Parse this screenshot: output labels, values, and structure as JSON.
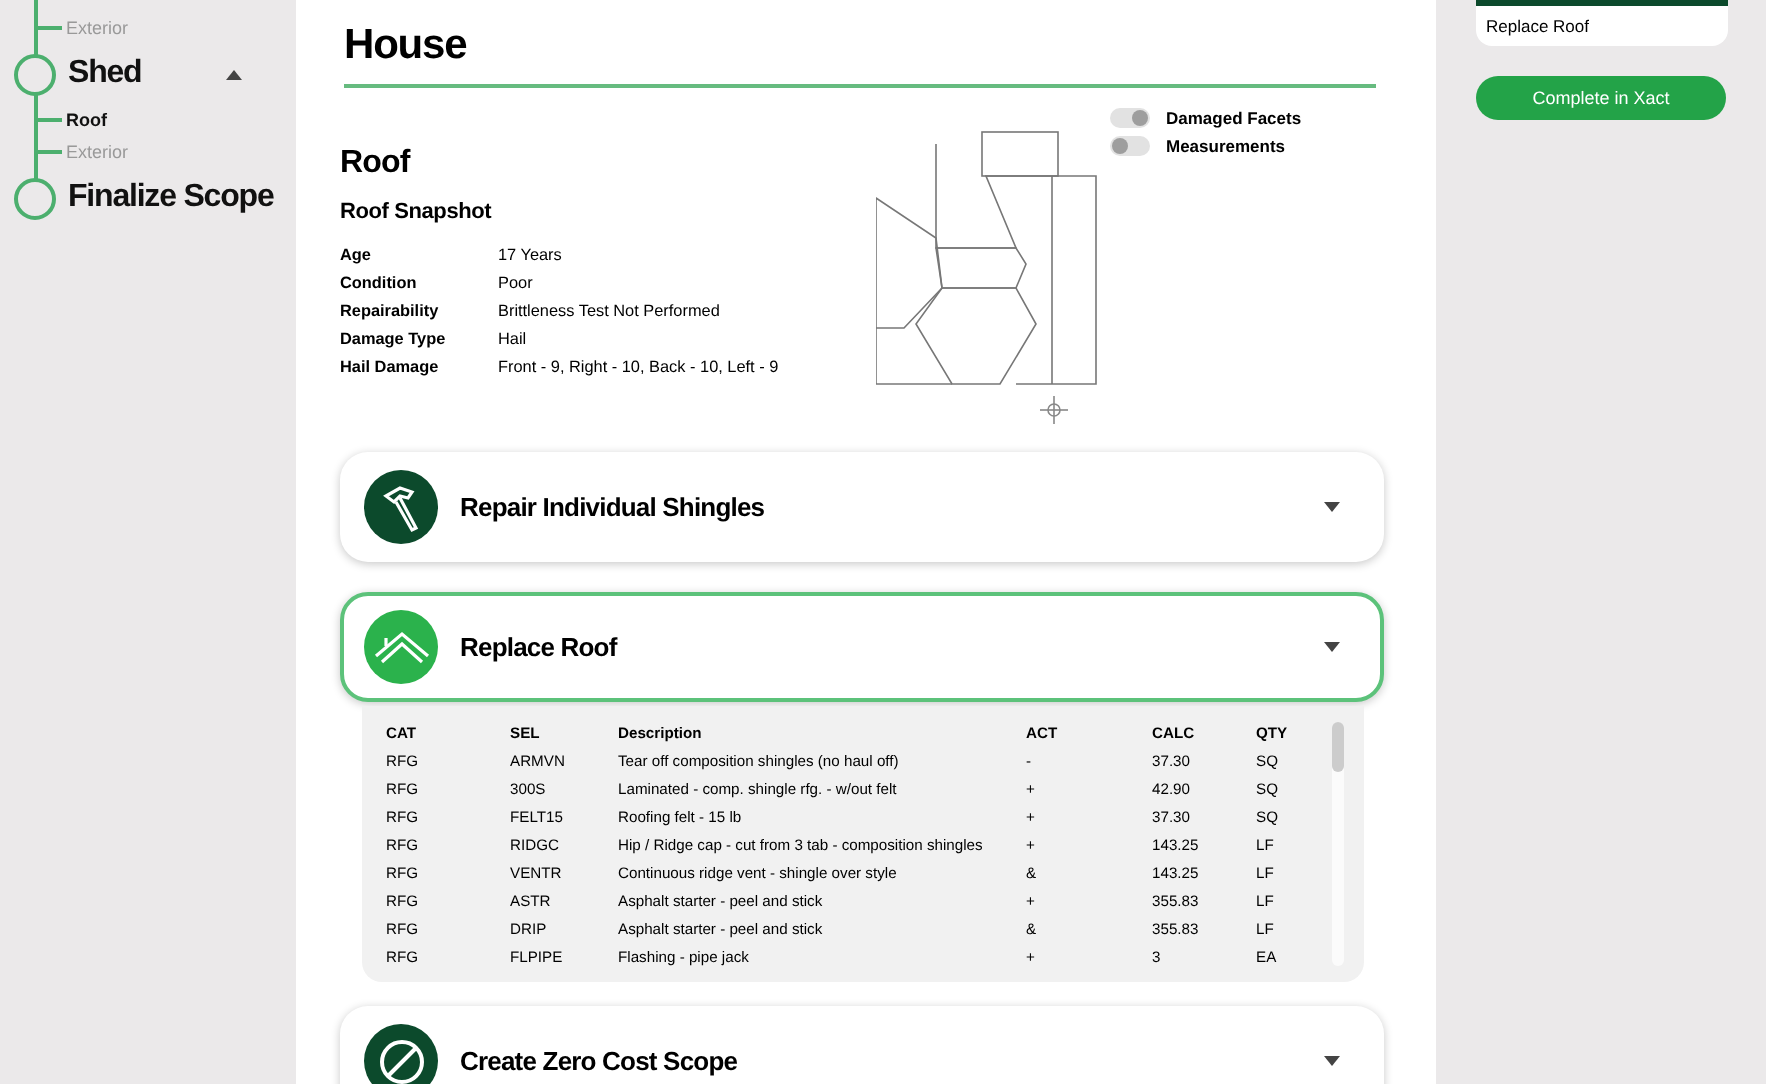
{
  "sidebar": {
    "items": [
      {
        "label": "Exterior",
        "kind": "sub",
        "selected": false
      },
      {
        "label": "Shed",
        "kind": "section",
        "expanded": true
      },
      {
        "label": "Roof",
        "kind": "sub",
        "selected": true
      },
      {
        "label": "Exterior",
        "kind": "sub",
        "selected": false
      },
      {
        "label": "Finalize Scope",
        "kind": "section"
      }
    ]
  },
  "main": {
    "title": "House",
    "toggles": [
      {
        "label": "Damaged Facets",
        "on": true
      },
      {
        "label": "Measurements",
        "on": false
      }
    ],
    "section_title": "Roof",
    "snapshot_title": "Roof Snapshot",
    "snapshot": [
      {
        "label": "Age",
        "value": "17 Years"
      },
      {
        "label": "Condition",
        "value": "Poor"
      },
      {
        "label": "Repairability",
        "value": "Brittleness Test Not Performed"
      },
      {
        "label": "Damage Type",
        "value": "Hail"
      },
      {
        "label": "Hail Damage",
        "value": "Front - 9, Right - 10, Back - 10, Left - 9"
      }
    ],
    "options": [
      {
        "title": "Repair Individual Shingles",
        "kind": "hammer",
        "selected": false
      },
      {
        "title": "Replace Roof",
        "kind": "roof",
        "selected": true,
        "expanded": true,
        "table": {
          "columns": [
            "CAT",
            "SEL",
            "Description",
            "ACT",
            "CALC",
            "QTY"
          ],
          "rows": [
            [
              "RFG",
              "ARMVN",
              "Tear off composition shingles (no haul off)",
              "-",
              "37.30",
              "SQ"
            ],
            [
              "RFG",
              "300S",
              "Laminated - comp. shingle rfg. - w/out felt",
              "+",
              "42.90",
              "SQ"
            ],
            [
              "RFG",
              "FELT15",
              "Roofing felt - 15 lb",
              "+",
              "37.30",
              "SQ"
            ],
            [
              "RFG",
              "RIDGC",
              "Hip / Ridge cap - cut from 3 tab - composition shingles",
              "+",
              "143.25",
              "LF"
            ],
            [
              "RFG",
              "VENTR",
              "Continuous ridge vent - shingle over style",
              "&",
              "143.25",
              "LF"
            ],
            [
              "RFG",
              "ASTR",
              "Asphalt starter - peel and stick",
              "+",
              "355.83",
              "LF"
            ],
            [
              "RFG",
              "DRIP",
              "Asphalt starter - peel and stick",
              "&",
              "355.83",
              "LF"
            ],
            [
              "RFG",
              "FLPIPE",
              "Flashing - pipe jack",
              "+",
              "3",
              "EA"
            ]
          ]
        }
      },
      {
        "title": "Create Zero Cost Scope",
        "kind": "zero",
        "selected": false
      }
    ]
  },
  "right_panel": {
    "selected_option": "Replace Roof",
    "button": "Complete in Xact"
  }
}
